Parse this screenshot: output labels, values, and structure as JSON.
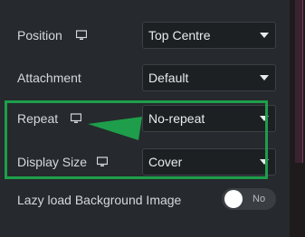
{
  "settings": {
    "position": {
      "label": "Position",
      "value": "Top Centre"
    },
    "attachment": {
      "label": "Attachment",
      "value": "Default"
    },
    "repeat": {
      "label": "Repeat",
      "value": "No-repeat"
    },
    "display_size": {
      "label": "Display Size",
      "value": "Cover"
    },
    "lazy_load": {
      "label": "Lazy load Background Image",
      "toggle_text": "No",
      "enabled": false
    }
  },
  "icons": {
    "responsive": "monitor-icon",
    "dropdown": "chevron-down-icon"
  },
  "colors": {
    "highlight": "#1e9e4a",
    "panel_bg": "#26292d",
    "select_bg": "#1d2023"
  }
}
